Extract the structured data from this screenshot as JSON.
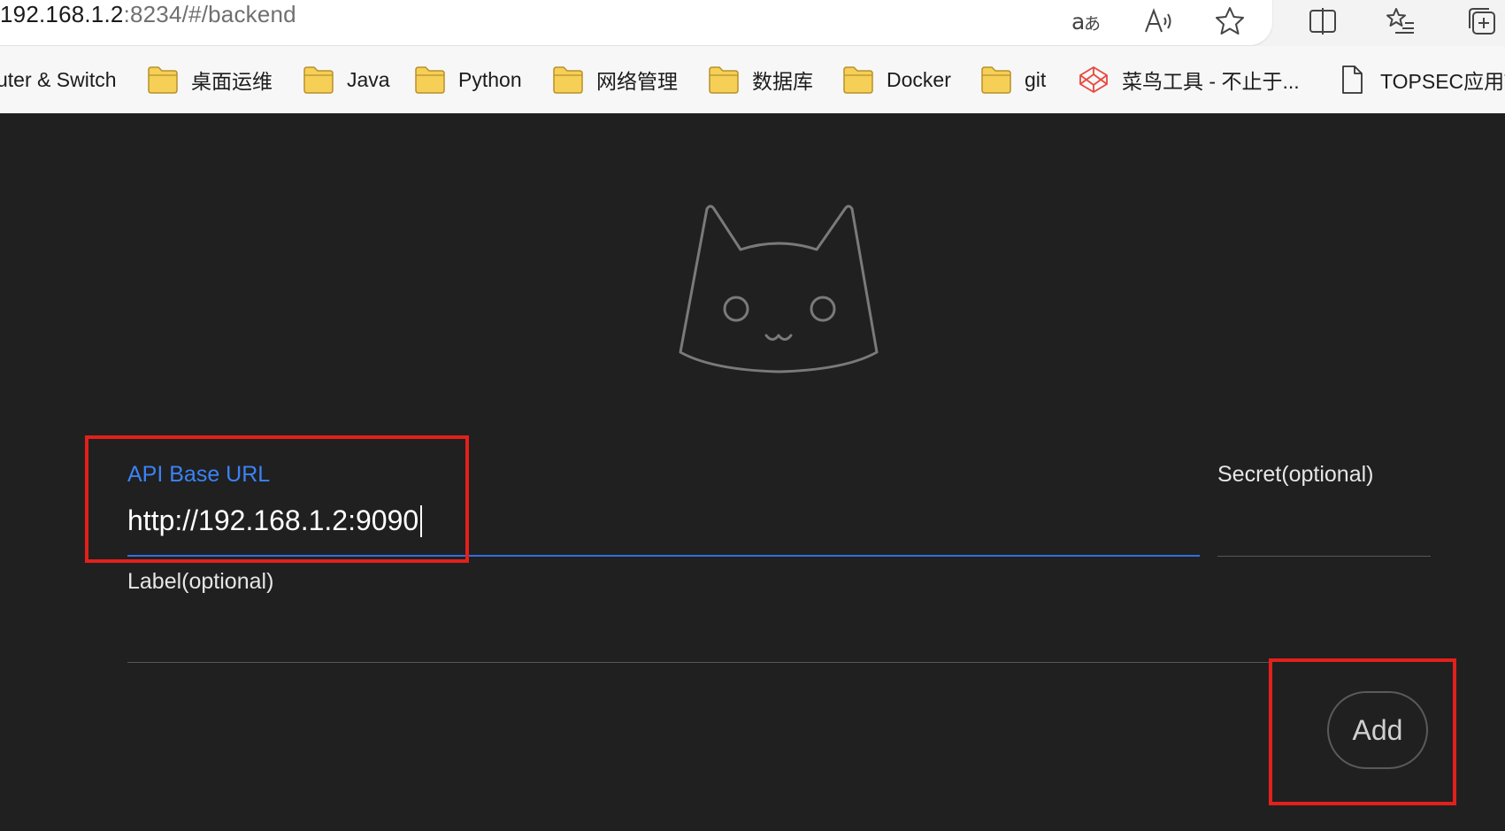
{
  "browser": {
    "url_host": "192.168.1.2",
    "url_rest": ":8234/#/backend",
    "toolbar_icons": [
      "translate-icon",
      "read-aloud-icon",
      "favorite-star-icon",
      "split-screen-icon",
      "favorites-list-icon",
      "collections-icon"
    ],
    "bookmarks": [
      {
        "label": "uter & Switch",
        "icon": "none"
      },
      {
        "label": "桌面运维",
        "icon": "folder-icon"
      },
      {
        "label": "Java",
        "icon": "folder-icon"
      },
      {
        "label": "Python",
        "icon": "folder-icon"
      },
      {
        "label": "网络管理",
        "icon": "folder-icon"
      },
      {
        "label": "数据库",
        "icon": "folder-icon"
      },
      {
        "label": "Docker",
        "icon": "folder-icon"
      },
      {
        "label": "git",
        "icon": "folder-icon"
      },
      {
        "label": "菜鸟工具 - 不止于...",
        "icon": "codepen-icon"
      },
      {
        "label": "TOPSEC应用T",
        "icon": "page-icon"
      }
    ]
  },
  "app": {
    "logo_icon": "cat-face-icon",
    "form": {
      "api_base_url_label": "API Base URL",
      "api_base_url_value": "http://192.168.1.2:9090",
      "secret_label": "Secret(optional)",
      "secret_value": "",
      "label_label": "Label(optional)",
      "label_value": "",
      "add_button": "Add"
    }
  },
  "colors": {
    "background": "#202020",
    "accent": "#3b82f6",
    "highlight_box": "#e3201b",
    "folder": "#f6cf57"
  }
}
